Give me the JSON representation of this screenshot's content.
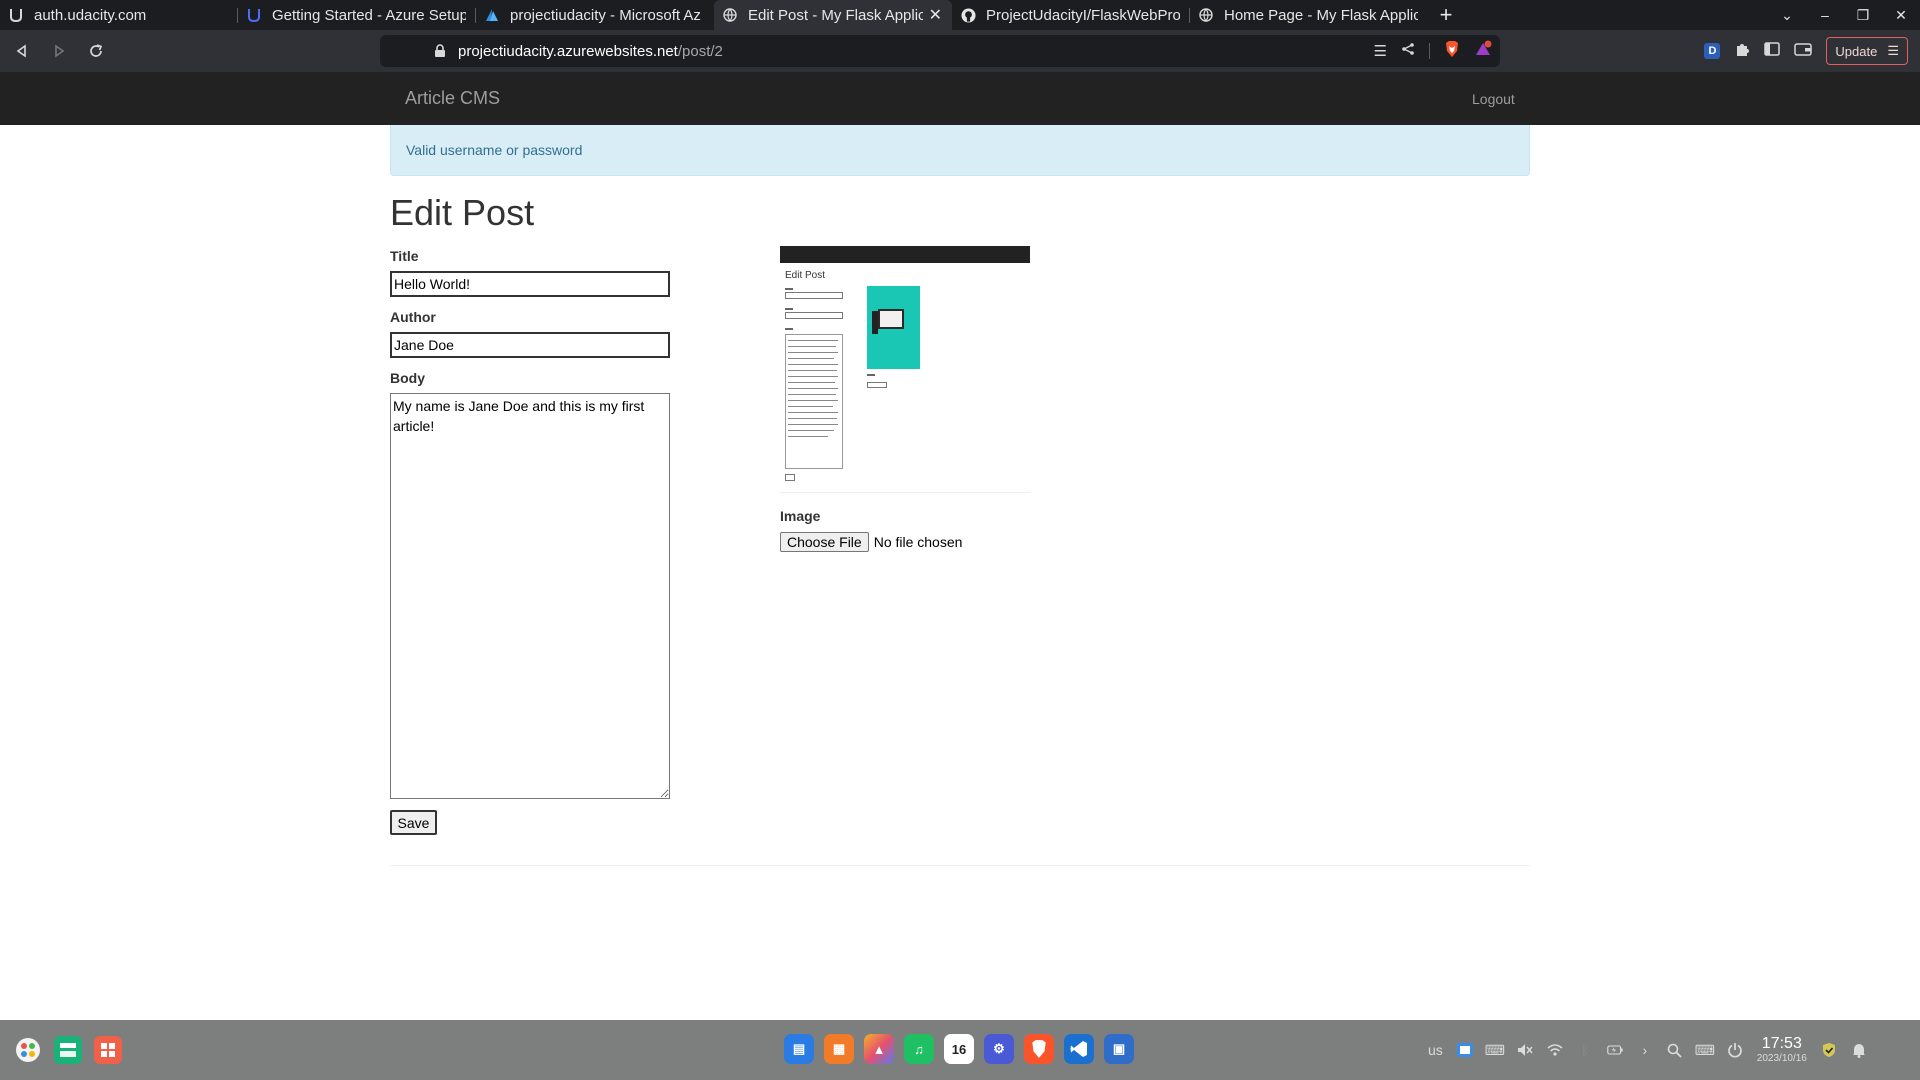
{
  "browser": {
    "tabs": [
      {
        "label": "auth.udacity.com",
        "icon": "udacity-icon",
        "active": false
      },
      {
        "label": "Getting Started - Azure Setup",
        "icon": "udacity-icon",
        "active": false
      },
      {
        "label": "projectiudacity - Microsoft Az",
        "icon": "azure-icon",
        "active": false
      },
      {
        "label": "Edit Post - My Flask Applic",
        "icon": "globe-icon",
        "active": true
      },
      {
        "label": "ProjectUdacityI/FlaskWebPro",
        "icon": "github-icon",
        "active": false
      },
      {
        "label": "Home Page - My Flask Applic",
        "icon": "globe-icon",
        "active": false
      }
    ],
    "new_tab": "+",
    "url_host": "projectiudacity.azurewebsites.net",
    "url_path": "/post/2",
    "update_label": "Update"
  },
  "site": {
    "brand": "Article CMS",
    "logout": "Logout"
  },
  "alert": "Valid username or password",
  "page_title": "Edit Post",
  "form": {
    "title_label": "Title",
    "title_value": "Hello World!",
    "author_label": "Author",
    "author_value": "Jane Doe",
    "body_label": "Body",
    "body_value": "My name is Jane Doe and this is my first article!",
    "save": "Save",
    "image_label": "Image",
    "choose_file": "Choose File",
    "no_file": "No file chosen"
  },
  "taskbar": {
    "calendar_day": "16",
    "keyboard_layout": "us",
    "time": "17:53",
    "date": "2023/10/16"
  },
  "colors": {
    "navbar": "#222222",
    "alert_bg": "#d9edf7",
    "alert_text": "#31708f",
    "thumb_accent": "#1ac7b4"
  }
}
